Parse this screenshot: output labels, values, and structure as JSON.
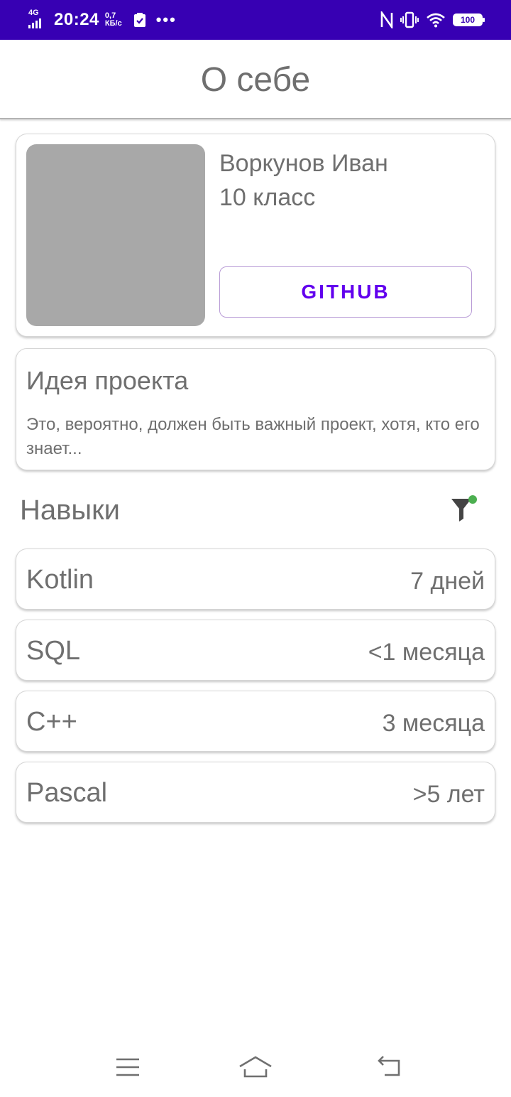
{
  "status_bar": {
    "network": "4G",
    "time": "20:24",
    "speed_value": "0,7",
    "speed_unit": "КБ/с",
    "more": "•••",
    "battery": "100"
  },
  "header": {
    "title": "О себе"
  },
  "profile": {
    "name": "Воркунов Иван",
    "grade": "10 класс",
    "github_label": "GITHUB"
  },
  "idea": {
    "title": "Идея проекта",
    "text": "Это, вероятно, должен быть важный проект, хотя, кто его знает..."
  },
  "skills": {
    "title": "Навыки",
    "filter_indicator_color": "#4caf50",
    "items": [
      {
        "name": "Kotlin",
        "duration": "7 дней"
      },
      {
        "name": "SQL",
        "duration": "<1 месяца"
      },
      {
        "name": "C++",
        "duration": "3 месяца"
      },
      {
        "name": "Pascal",
        "duration": ">5 лет"
      }
    ]
  },
  "colors": {
    "status_bar": "#3700b3",
    "accent": "#6200ee",
    "text": "#6f6f6f"
  },
  "nav": {
    "icons": [
      "menu-icon",
      "home-icon",
      "back-icon"
    ]
  }
}
